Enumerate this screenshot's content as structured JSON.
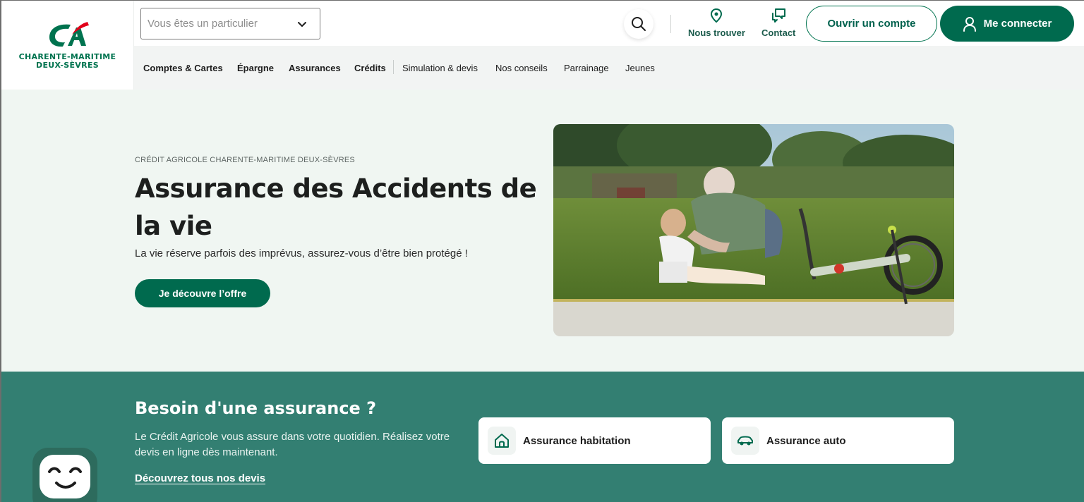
{
  "brand": {
    "logo_letters": "CA",
    "region_line1": "CHARENTE-MARITIME",
    "region_line2": "DEUX-SÈVRES",
    "primary_color": "#006a4e",
    "accent_red": "#e2001a"
  },
  "header": {
    "profile_select_placeholder": "Vous êtes un particulier",
    "search_icon": "search-icon",
    "find_us_label": "Nous trouver",
    "contact_label": "Contact",
    "open_account_label": "Ouvrir un compte",
    "login_label": "Me connecter"
  },
  "nav": {
    "items": [
      {
        "label": "Comptes & Cartes"
      },
      {
        "label": "Épargne"
      },
      {
        "label": "Assurances"
      },
      {
        "label": "Crédits"
      },
      {
        "label": "Simulation & devis"
      },
      {
        "label": "Nos conseils"
      },
      {
        "label": "Parrainage"
      },
      {
        "label": "Jeunes"
      }
    ]
  },
  "hero": {
    "eyebrow": "CRÉDIT AGRICOLE CHARENTE-MARITIME DEUX-SÈVRES",
    "title": "Assurance des Accidents de la vie",
    "subtitle": "La vie réserve parfois des imprévus, assurez-vous d’être bien protégé !",
    "cta_label": "Je découvre l’offre"
  },
  "insurance": {
    "title": "Besoin d'une assurance ?",
    "text": "Le Crédit Agricole vous assure dans votre quotidien. Réalisez votre devis en ligne dès maintenant.",
    "link_label": "Découvrez tous nos devis",
    "cards": [
      {
        "label": "Assurance habitation",
        "icon": "house-icon"
      },
      {
        "label": "Assurance auto",
        "icon": "car-icon"
      }
    ]
  }
}
